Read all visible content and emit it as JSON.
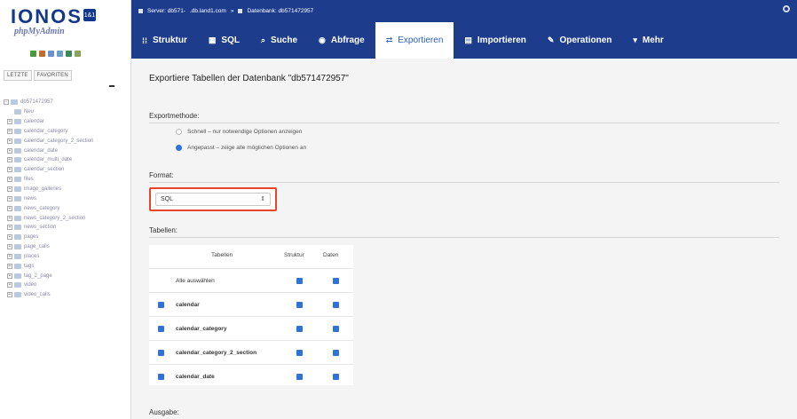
{
  "sidebar": {
    "logo_text": "IONOS",
    "logo_badge": "1&1",
    "logo_sub": "phpMyAdmin",
    "tabs": [
      "LETZTE",
      "FAVORITEN"
    ],
    "tool_colors": [
      "#4a9a3a",
      "#c46a2b",
      "#6b8fd0",
      "#6aa0c8",
      "#3a8a55",
      "#8aa35a"
    ],
    "tree": [
      {
        "label": "db571472957",
        "type": "db"
      },
      {
        "label": "Neu",
        "type": "neu"
      },
      {
        "label": "calendar",
        "type": "tbl"
      },
      {
        "label": "calendar_category",
        "type": "tbl"
      },
      {
        "label": "calendar_category_2_section",
        "type": "tbl"
      },
      {
        "label": "calendar_date",
        "type": "tbl"
      },
      {
        "label": "calendar_multi_date",
        "type": "tbl"
      },
      {
        "label": "calendar_section",
        "type": "tbl"
      },
      {
        "label": "files",
        "type": "tbl"
      },
      {
        "label": "image_galleries",
        "type": "tbl"
      },
      {
        "label": "news",
        "type": "tbl"
      },
      {
        "label": "news_category",
        "type": "tbl"
      },
      {
        "label": "news_category_2_section",
        "type": "tbl"
      },
      {
        "label": "news_section",
        "type": "tbl"
      },
      {
        "label": "pages",
        "type": "tbl"
      },
      {
        "label": "page_calls",
        "type": "tbl"
      },
      {
        "label": "places",
        "type": "tbl"
      },
      {
        "label": "tags",
        "type": "tbl"
      },
      {
        "label": "tag_2_page",
        "type": "tbl"
      },
      {
        "label": "video",
        "type": "tbl"
      },
      {
        "label": "video_calls",
        "type": "tbl"
      }
    ]
  },
  "breadcrumb": {
    "server": "Server: db571-",
    "host": ".db.land1.com",
    "sep": "»",
    "database": "Datenbank: db571472957"
  },
  "nav": {
    "tabs": [
      {
        "label": "Struktur",
        "icon": "structure-icon",
        "glyph": "⁞⁞"
      },
      {
        "label": "SQL",
        "icon": "sql-icon",
        "glyph": "▦"
      },
      {
        "label": "Suche",
        "icon": "search-icon",
        "glyph": "⌕"
      },
      {
        "label": "Abfrage",
        "icon": "query-icon",
        "glyph": "◉"
      },
      {
        "label": "Exportieren",
        "icon": "export-icon",
        "glyph": "⇄",
        "active": true
      },
      {
        "label": "Importieren",
        "icon": "import-icon",
        "glyph": "▤"
      },
      {
        "label": "Operationen",
        "icon": "wrench-icon",
        "glyph": "✎"
      },
      {
        "label": "Mehr",
        "icon": "chevron-down-icon",
        "glyph": "▾"
      }
    ]
  },
  "main": {
    "title": "Exportiere Tabellen der Datenbank \"db571472957\"",
    "exportmethode_label": "Exportmethode:",
    "method_quick": "Schnell – nur notwendige Optionen anzeigen",
    "method_custom": "Angepasst – zeige alle möglichen Optionen an",
    "format_label": "Format:",
    "format_value": "SQL",
    "tabellen_label": "Tabellen:",
    "table_headers": {
      "tables": "Tabellen",
      "structure": "Struktur",
      "data": "Daten"
    },
    "select_all": "Alle auswählen",
    "rows": [
      "calendar",
      "calendar_category",
      "calendar_category_2_section",
      "calendar_date"
    ],
    "ausgabe_label": "Ausgabe:"
  },
  "colors": {
    "nav_bg": "#1d3d8c",
    "accent_blue": "#2f73d6",
    "highlight_red": "#e8452c"
  }
}
